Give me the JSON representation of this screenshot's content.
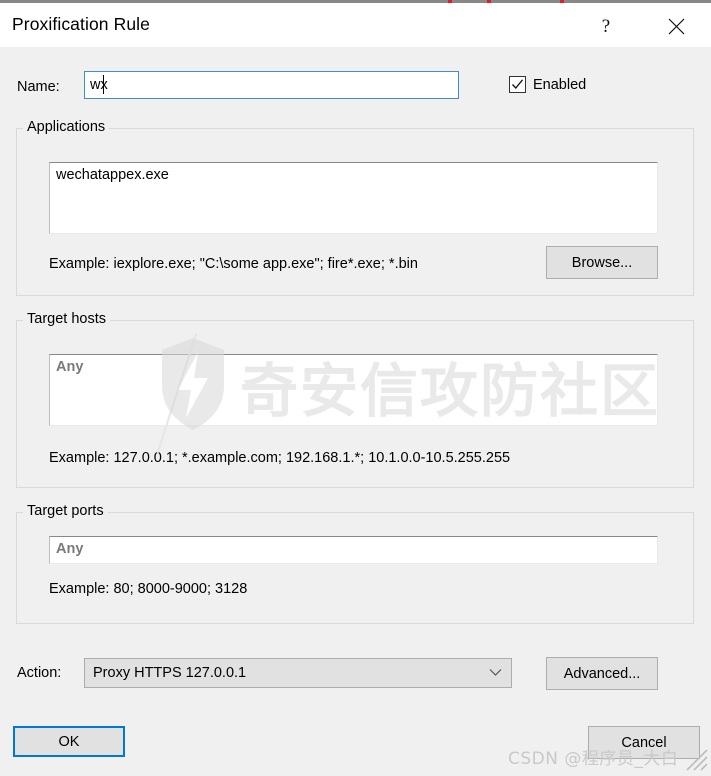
{
  "window": {
    "title": "Proxification Rule",
    "help_icon": "question-mark-icon",
    "close_icon": "close-icon"
  },
  "name_row": {
    "label": "Name:",
    "value": "wx",
    "placeholder": "",
    "enabled_label": "Enabled",
    "enabled_checked": true
  },
  "applications": {
    "legend": "Applications",
    "value": "wechatappex.exe",
    "hint": "Example: iexplore.exe; \"C:\\some app.exe\"; fire*.exe; *.bin",
    "browse_label": "Browse..."
  },
  "target_hosts": {
    "legend": "Target hosts",
    "value": "Any",
    "is_placeholder": true,
    "hint": "Example: 127.0.0.1; *.example.com; 192.168.1.*; 10.1.0.0-10.5.255.255"
  },
  "target_ports": {
    "legend": "Target ports",
    "value": "Any",
    "is_placeholder": true,
    "hint": "Example: 80; 8000-9000; 3128"
  },
  "action_row": {
    "label": "Action:",
    "selected": "Proxy HTTPS 127.0.0.1",
    "chevron_icon": "chevron-down-icon",
    "advanced_label": "Advanced..."
  },
  "footer": {
    "ok_label": "OK",
    "cancel_label": "Cancel"
  },
  "watermarks": {
    "center_text": "奇安信攻防社区",
    "bottom_text": "CSDN @程序员_大白"
  },
  "colors": {
    "focus_blue": "#0078d7",
    "input_border_focus": "#3d8ec9",
    "window_bg": "#f0f0f0",
    "titlebar_bg": "#ffffff",
    "button_bg": "#e1e1e1",
    "group_border": "#d9d9d9",
    "placeholder_gray": "#7a7a7a",
    "tick_red": "#e02020"
  }
}
